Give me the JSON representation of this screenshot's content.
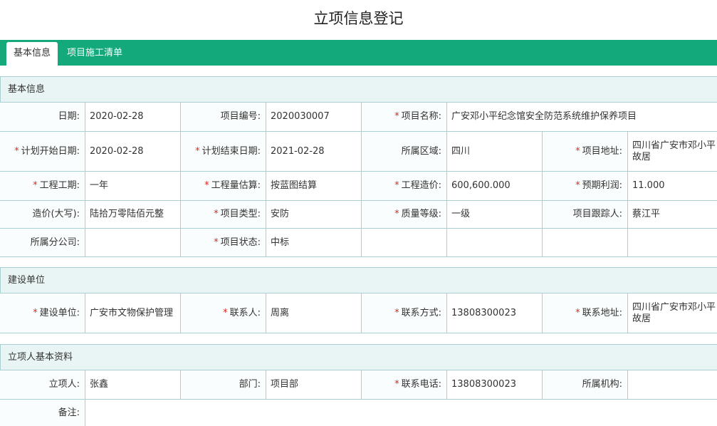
{
  "page_title": "立项信息登记",
  "tabs": [
    {
      "label": "基本信息",
      "active": true
    },
    {
      "label": "项目施工清单",
      "active": false
    }
  ],
  "colors": {
    "tab_bar": "#13a97b",
    "section_bg": "#e9f4f4",
    "border": "#a9cfd0",
    "required": "#e0271f"
  },
  "sections": {
    "basic": "基本信息",
    "construction_unit": "建设单位",
    "applicant": "立项人基本资料"
  },
  "basic": {
    "date": {
      "label": "日期:",
      "value": "2020-02-28"
    },
    "project_no": {
      "label": "项目编号:",
      "value": "2020030007"
    },
    "project_name": {
      "label": "项目名称:",
      "value": "广安邓小平纪念馆安全防范系统维护保养项目"
    },
    "plan_start": {
      "label": "计划开始日期:",
      "value": "2020-02-28"
    },
    "plan_end": {
      "label": "计划结束日期:",
      "value": "2021-02-28"
    },
    "region": {
      "label": "所属区域:",
      "value": "四川"
    },
    "address": {
      "label": "项目地址:",
      "value": "四川省广安市邓小平故居"
    },
    "duration": {
      "label": "工程工期:",
      "value": "一年"
    },
    "quantity_estimate": {
      "label": "工程量估算:",
      "value": "按蓝图结算"
    },
    "cost": {
      "label": "工程造价:",
      "value": "600,600.000"
    },
    "expected_profit": {
      "label": "预期利润:",
      "value": "11.000"
    },
    "cost_upper": {
      "label": "造价(大写):",
      "value": "陆拾万零陆佰元整"
    },
    "project_type": {
      "label": "项目类型:",
      "value": "安防"
    },
    "quality_grade": {
      "label": "质量等级:",
      "value": "一级"
    },
    "tracker": {
      "label": "项目跟踪人:",
      "value": "蔡江平"
    },
    "branch": {
      "label": "所属分公司:",
      "value": ""
    },
    "status": {
      "label": "项目状态:",
      "value": "中标"
    }
  },
  "construction": {
    "unit": {
      "label": "建设单位:",
      "value": "广安市文物保护管理"
    },
    "contact": {
      "label": "联系人:",
      "value": "周离"
    },
    "contact_method": {
      "label": "联系方式:",
      "value": "13808300023"
    },
    "contact_address": {
      "label": "联系地址:",
      "value": "四川省广安市邓小平故居"
    }
  },
  "applicant": {
    "person": {
      "label": "立项人:",
      "value": "张鑫"
    },
    "department": {
      "label": "部门:",
      "value": "项目部"
    },
    "phone": {
      "label": "联系电话:",
      "value": "13808300023"
    },
    "org": {
      "label": "所属机构:",
      "value": ""
    },
    "remark": {
      "label": "备注:",
      "value": ""
    }
  }
}
